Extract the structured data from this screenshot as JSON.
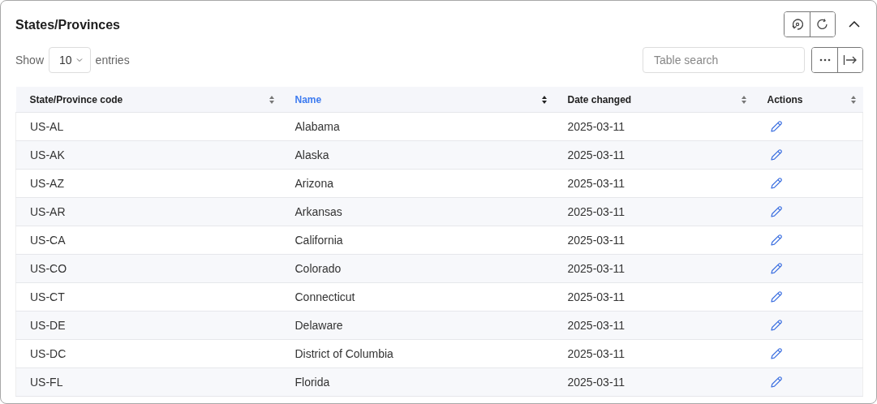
{
  "panel": {
    "title": "States/Provinces",
    "expanded": true
  },
  "length_menu": {
    "label_before": "Show",
    "value": "10",
    "label_after": "entries"
  },
  "search": {
    "placeholder": "Table search"
  },
  "table": {
    "columns": [
      {
        "label": "State/Province code",
        "selected": false
      },
      {
        "label": "Name",
        "selected": true
      },
      {
        "label": "Date changed",
        "selected": false
      },
      {
        "label": "Actions",
        "selected": false
      }
    ],
    "rows": [
      {
        "code": "US-AL",
        "name": "Alabama",
        "date": "2025-03-11"
      },
      {
        "code": "US-AK",
        "name": "Alaska",
        "date": "2025-03-11"
      },
      {
        "code": "US-AZ",
        "name": "Arizona",
        "date": "2025-03-11"
      },
      {
        "code": "US-AR",
        "name": "Arkansas",
        "date": "2025-03-11"
      },
      {
        "code": "US-CA",
        "name": "California",
        "date": "2025-03-11"
      },
      {
        "code": "US-CO",
        "name": "Colorado",
        "date": "2025-03-11"
      },
      {
        "code": "US-CT",
        "name": "Connecticut",
        "date": "2025-03-11"
      },
      {
        "code": "US-DE",
        "name": "Delaware",
        "date": "2025-03-11"
      },
      {
        "code": "US-DC",
        "name": "District of Columbia",
        "date": "2025-03-11"
      },
      {
        "code": "US-FL",
        "name": "Florida",
        "date": "2025-03-11"
      }
    ]
  }
}
